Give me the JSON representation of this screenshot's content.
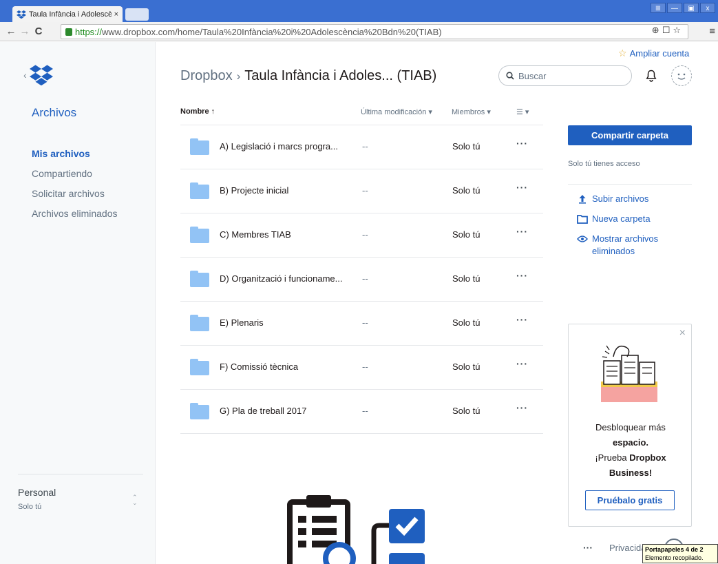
{
  "browser": {
    "tab_title": "Taula Infància i Adolescència",
    "tab_close": "×",
    "url_prefix": "https://",
    "url_rest": "www.dropbox.com/home/Taula%20Infància%20i%20Adolescència%20Bdn%20(TIAB)",
    "window_buttons": [
      "≣",
      "—",
      "▣",
      "x"
    ],
    "menu": "≡"
  },
  "sidebar": {
    "title": "Archivos",
    "items": [
      {
        "label": "Mis archivos",
        "active": true
      },
      {
        "label": "Compartiendo",
        "active": false
      },
      {
        "label": "Solicitar archivos",
        "active": false
      },
      {
        "label": "Archivos eliminados",
        "active": false
      }
    ],
    "account": {
      "name": "Personal",
      "subtitle": "Solo tú"
    }
  },
  "header": {
    "upgrade": "Ampliar cuenta",
    "breadcrumb_root": "Dropbox",
    "breadcrumb_sep": "›",
    "breadcrumb_current": "Taula Infància i Adoles... (TIAB)",
    "search_placeholder": "Buscar"
  },
  "table": {
    "columns": {
      "name": "Nombre ↑",
      "modified": "Última modificación ▾",
      "members": "Miembros ▾",
      "view": "☰ ▾"
    },
    "rows": [
      {
        "name": "A) Legislació i marcs progra...",
        "modified": "--",
        "members": "Solo tú",
        "more": "···"
      },
      {
        "name": "B) Projecte inicial",
        "modified": "--",
        "members": "Solo tú",
        "more": "···"
      },
      {
        "name": "C) Membres TIAB",
        "modified": "--",
        "members": "Solo tú",
        "more": "···"
      },
      {
        "name": "D) Organització i funcioname...",
        "modified": "--",
        "members": "Solo tú",
        "more": "···"
      },
      {
        "name": "E) Plenaris",
        "modified": "--",
        "members": "Solo tú",
        "more": "···"
      },
      {
        "name": "F) Comissió tècnica",
        "modified": "--",
        "members": "Solo tú",
        "more": "···"
      },
      {
        "name": "G) Pla de treball 2017",
        "modified": "--",
        "members": "Solo tú",
        "more": "···"
      }
    ]
  },
  "right_panel": {
    "share_button": "Compartir carpeta",
    "access_note": "Solo tú tienes acceso",
    "actions": [
      {
        "label": "Subir archivos",
        "icon": "upload-icon"
      },
      {
        "label": "Nueva carpeta",
        "icon": "new-folder-icon"
      },
      {
        "label": "Mostrar archivos eliminados",
        "icon": "eye-icon"
      }
    ]
  },
  "promo": {
    "close": "×",
    "line1": "Desbloquear más",
    "line2": "espacio.",
    "line3_prefix": "¡Prueba ",
    "line3_bold": "Dropbox",
    "line4": "Business!",
    "button": "Pruébalo gratis"
  },
  "footer": {
    "more": "···",
    "privacy": "Privacida"
  },
  "tooltip": {
    "title": "Portapapeles 4 de 2",
    "body": "Elemento recopilado."
  },
  "colors": {
    "accent": "#1f5fbf",
    "folder": "#92c3f5",
    "chrome_blue": "#3a6fd1"
  }
}
